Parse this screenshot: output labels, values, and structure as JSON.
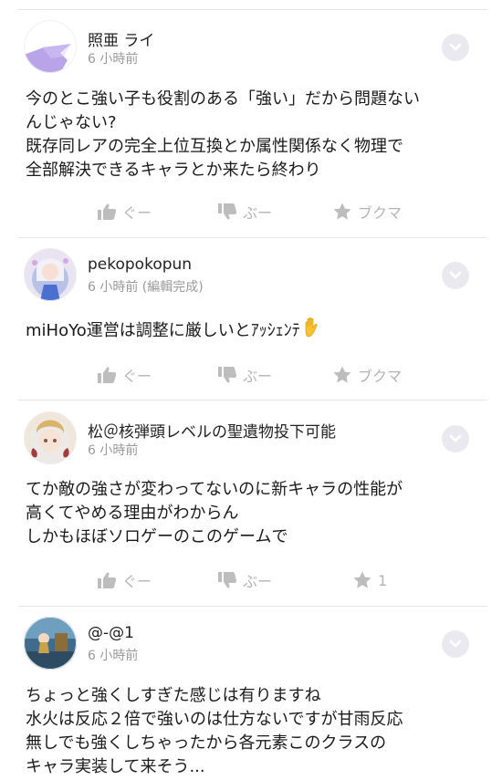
{
  "posts": [
    {
      "author": "照亜 ライ",
      "time": "6 小時前",
      "lines": [
        "今のとこ強い子も役割のある「強い」だから問題ない",
        "んじゃない?",
        "既存同レアの完全上位互換とか属性関係なく物理で",
        "全部解決できるキャラとか来たら終わり"
      ],
      "actions": {
        "like": "ぐー",
        "dislike": "ぶー",
        "bookmark": "ブクマ"
      }
    },
    {
      "author": "pekopokopun",
      "time": "6 小時前 (編輯完成)",
      "lines": [
        "miHoYo運営は調整に厳しいとｱｯｼｪﾝﾃ"
      ],
      "emoji": "raised-hand-emoji",
      "actions": {
        "like": "ぐー",
        "dislike": "ぶー",
        "bookmark": "ブクマ"
      }
    },
    {
      "author": "松＠核弾頭レベルの聖遺物投下可能",
      "time": "6 小時前",
      "lines": [
        "てか敵の強さが変わってないのに新キャラの性能が",
        "高くてやめる理由がわからん",
        "しかもほぼソロゲーのこのゲームで"
      ],
      "actions": {
        "like": "ぐー",
        "dislike": "ぶー",
        "bookmark": "1"
      }
    },
    {
      "author": "@-@1",
      "time": "6 小時前",
      "lines": [
        "ちょっと強くしすぎた感じは有りますね",
        "水火は反応２倍で強いのは仕方ないですが甘雨反応",
        "無しでも強くしちゃったから各元素このクラスの",
        "キャラ実装して来そう..."
      ]
    }
  ],
  "colors": {
    "text": "#1a1a1a",
    "muted": "#9a9a9a",
    "action": "#b4b4b4",
    "menu_bg": "#e9e9ef",
    "divider": "#e6e6e6"
  },
  "icons": {
    "menu": "chevron-down-icon",
    "like": "thumbs-up-icon",
    "dislike": "thumbs-down-icon",
    "bookmark": "star-icon"
  }
}
